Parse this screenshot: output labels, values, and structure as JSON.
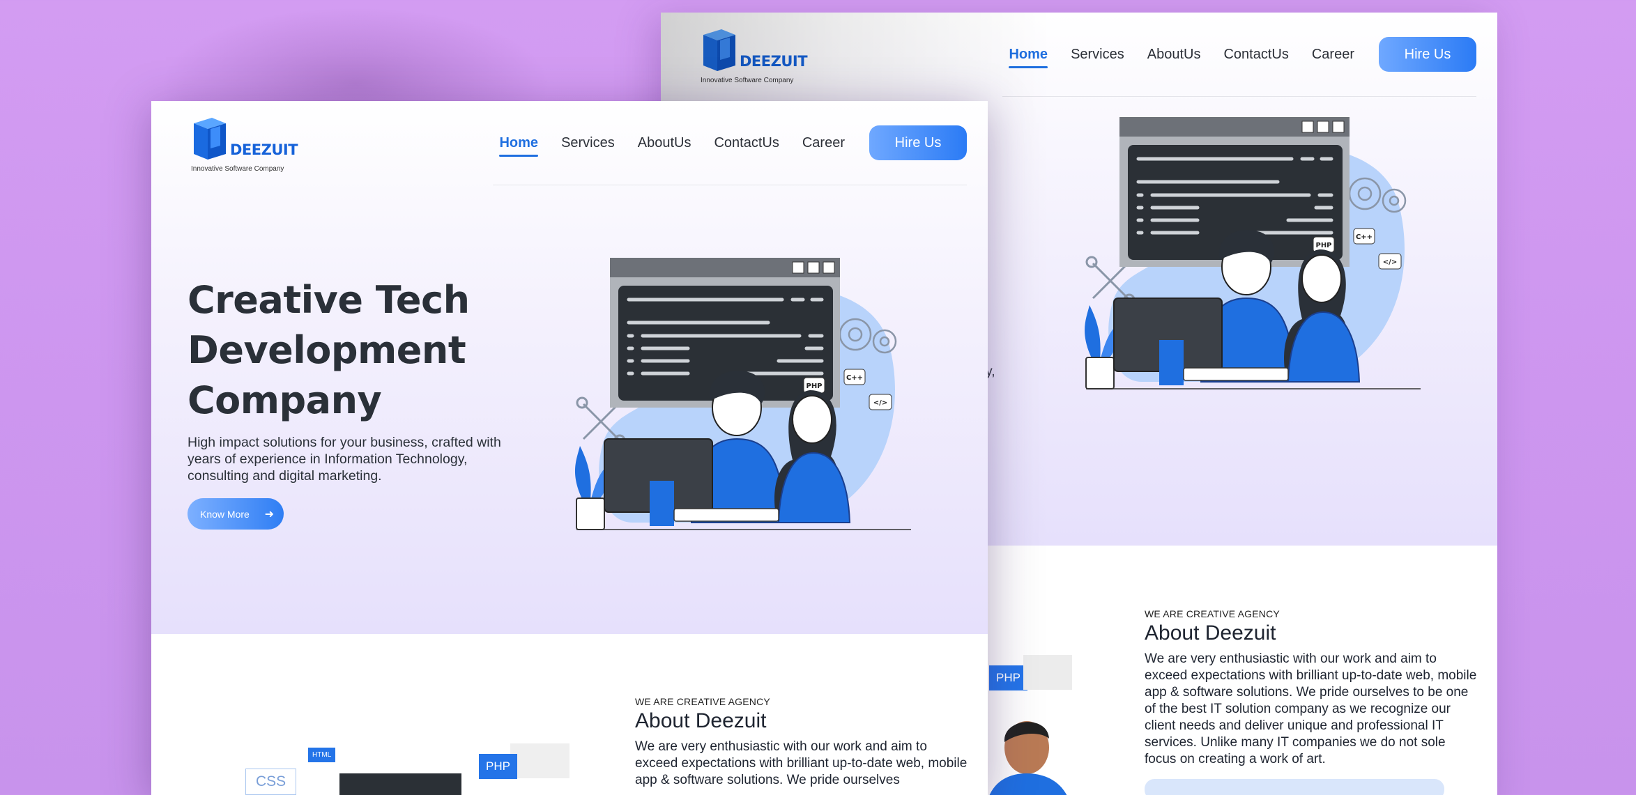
{
  "brand": {
    "name": "DEEZUIT",
    "tagline": "Innovative Software Company",
    "primary_color": "#1f6fe0",
    "background_color": "#d39cf2"
  },
  "nav": {
    "items": [
      "Home",
      "Services",
      "AboutUs",
      "ContactUs",
      "Career"
    ],
    "active": "Home",
    "cta": "Hire Us"
  },
  "hero": {
    "headline_lines": [
      "Creative Tech",
      "Development",
      "Company"
    ],
    "subtext": "High impact solutions for your business, crafted with years of experience in Information Technology, consulting and digital marketing.",
    "button": "Know More",
    "back_fragment": "ogy,"
  },
  "illustration": {
    "tags": [
      "PHP",
      "C++",
      "</>"
    ],
    "icons": [
      "code-window-icon",
      "gears-icon",
      "tools-icon",
      "plant-icon",
      "monitor-icon"
    ]
  },
  "about": {
    "eyebrow": "WE ARE CREATIVE AGENCY",
    "title": "About Deezuit",
    "body_front": "We are very enthusiastic with our work and aim to exceed expectations with brilliant up-to-date web, mobile app & software solutions. We pride ourselves",
    "body_back": "We are very enthusiastic with our work and aim to exceed expectations with brilliant up-to-date web, mobile app & software solutions. We pride ourselves to be one of the best IT solution company as we recognize our client needs and deliver unique and professional IT services. Unlike many IT companies we do not sole focus on creating a work of art.",
    "tags": {
      "css": "CSS",
      "html": "HTML",
      "php": "PHP",
      "code": "</>"
    }
  }
}
